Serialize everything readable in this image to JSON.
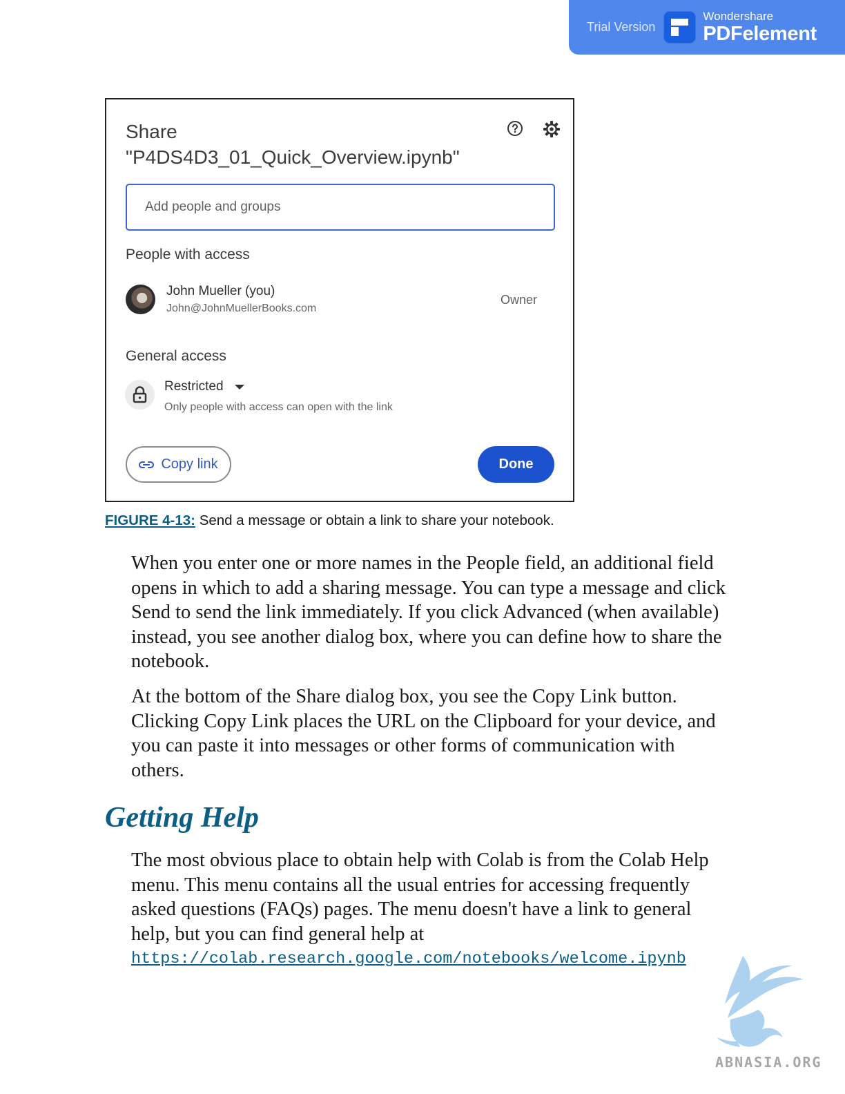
{
  "banner": {
    "trial_label": "Trial Version",
    "brand_small": "Wondershare",
    "brand_big": "PDFelement"
  },
  "dialog": {
    "title_line1": "Share",
    "title_line2": "\"P4DS4D3_01_Quick_Overview.ipynb\"",
    "add_placeholder": "Add people and groups",
    "people_heading": "People with access",
    "person": {
      "name": "John Mueller (you)",
      "email": "John@JohnMuellerBooks.com",
      "role": "Owner"
    },
    "general_heading": "General access",
    "access_level": "Restricted",
    "access_description": "Only people with access can open with the link",
    "copy_link_label": "Copy link",
    "done_label": "Done",
    "accent_color": "#1d52cf"
  },
  "caption": {
    "label": "FIGURE 4-13:",
    "text": " Send a message or obtain a link to share your notebook."
  },
  "body": {
    "paragraph1": "When you enter one or more names in the People field, an additional field opens in which to add a sharing message. You can type a message and click Send to send the link immediately. If you click Advanced (when available) instead, you see another dialog box, where you can define how to share the notebook.",
    "paragraph2": "At the bottom of the Share dialog box, you see the Copy Link button. Clicking Copy Link places the URL on the Clipboard for your device, and you can paste it into messages or other forms of communication with others.",
    "heading": "Getting Help",
    "paragraph3": "The most obvious place to obtain help with Colab is from the Colab Help menu. This menu contains all the usual entries for accessing frequently asked questions (FAQs) pages. The menu doesn't have a link to general help, but you can find general help at",
    "url": "https://colab.research.google.com/notebooks/welcome.ipynb"
  },
  "watermark": {
    "text": "ABNASIA.ORG"
  }
}
